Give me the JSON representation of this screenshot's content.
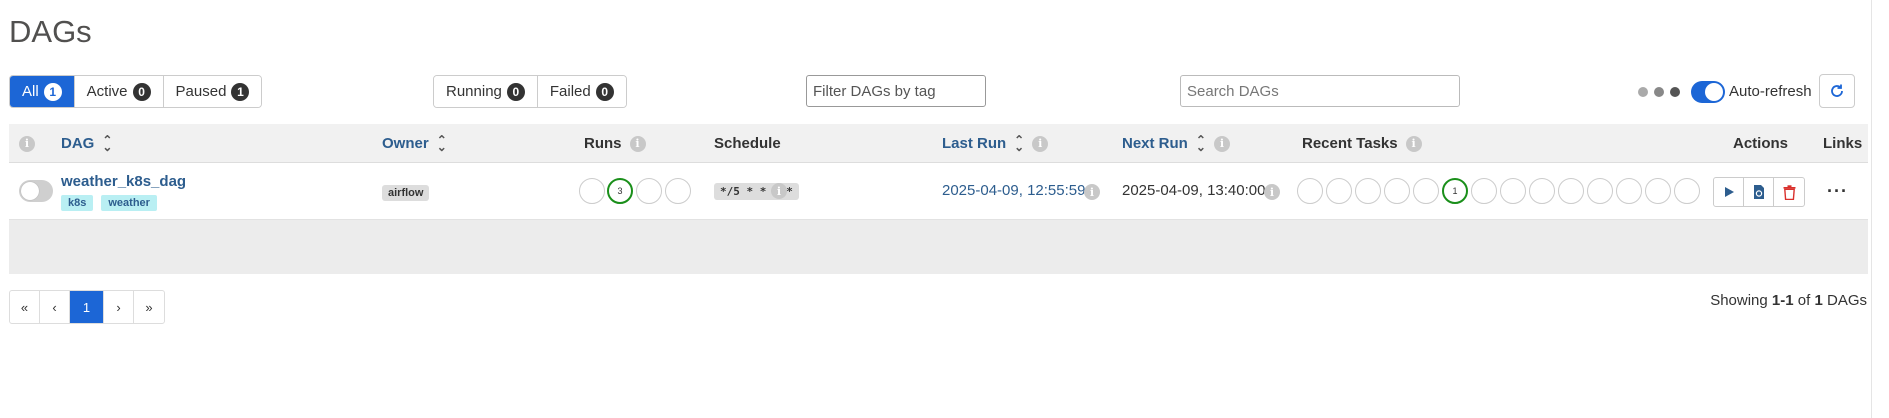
{
  "page": {
    "title": "DAGs"
  },
  "status_filter": [
    {
      "label": "All",
      "count": "1"
    },
    {
      "label": "Active",
      "count": "0"
    },
    {
      "label": "Paused",
      "count": "1"
    }
  ],
  "run_filter": [
    {
      "label": "Running",
      "count": "0"
    },
    {
      "label": "Failed",
      "count": "0"
    }
  ],
  "tag_filter": {
    "placeholder": "Filter DAGs by tag"
  },
  "search": {
    "placeholder": "Search DAGs"
  },
  "autorefresh": {
    "label": "Auto-refresh",
    "enabled": true
  },
  "columns": {
    "dag": "DAG",
    "owner": "Owner",
    "runs": "Runs",
    "schedule": "Schedule",
    "last_run": "Last Run",
    "next_run": "Next Run",
    "recent_tasks": "Recent Tasks",
    "actions": "Actions",
    "links": "Links"
  },
  "dags": [
    {
      "dag_id": "weather_k8s_dag",
      "paused": true,
      "tags": [
        "k8s",
        "weather"
      ],
      "owner": "airflow",
      "runs_success_count": "3",
      "schedule": "*/5 * * * *",
      "last_run": "2025-04-09, 12:55:59",
      "next_run": "2025-04-09, 13:40:00",
      "recent_tasks_success_count": "1"
    }
  ],
  "pagination": {
    "pages": [
      "«",
      "‹",
      "1",
      "›",
      "»"
    ],
    "current": "1"
  },
  "showing": {
    "prefix": "Showing",
    "range": "1-1",
    "of": "of",
    "total": "1",
    "suffix": "DAGs"
  },
  "colors": {
    "primary": "#1c66d6",
    "link": "#2d5d8e",
    "success": "#1a8f1a",
    "delete": "#d9302c"
  }
}
